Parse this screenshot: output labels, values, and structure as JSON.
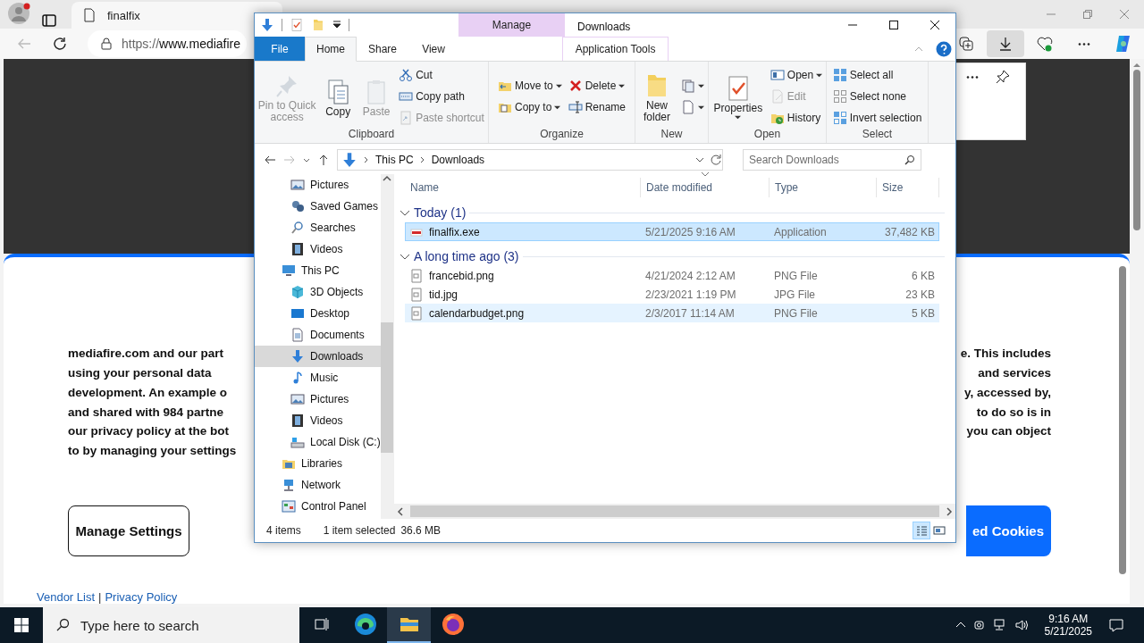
{
  "browser": {
    "tab": {
      "title": "finalfix"
    },
    "address": {
      "scheme": "https://",
      "host": "www.mediafire"
    },
    "toolbar_buttons": [
      {
        "kind": "collections",
        "selected": false
      },
      {
        "kind": "downloads",
        "selected": true
      },
      {
        "kind": "health",
        "selected": false
      },
      {
        "kind": "more",
        "selected": false
      },
      {
        "kind": "copilot",
        "selected": false
      }
    ]
  },
  "cookie_notice": {
    "left_lines": [
      "mediafire.com and our part",
      "using your personal data",
      "development. An example o",
      "and shared with 984 partne",
      "our privacy policy at the bot",
      "to by managing your settings"
    ],
    "right_lines": [
      "e. This includes",
      "and services",
      "y, accessed by,",
      "to do so is in",
      "you can object"
    ],
    "manage_button": "Manage Settings",
    "accept_button": "ed Cookies",
    "links": [
      "Vendor List",
      "Privacy Policy"
    ],
    "link_separator": "|"
  },
  "explorer": {
    "title": "Downloads",
    "context_group": "Manage",
    "tabs": [
      {
        "label": "File",
        "kind": "file",
        "selected": false
      },
      {
        "label": "Home",
        "kind": "tab",
        "selected": true
      },
      {
        "label": "Share",
        "kind": "tab",
        "selected": false
      },
      {
        "label": "View",
        "kind": "tab",
        "selected": false
      },
      {
        "label": "Application Tools",
        "kind": "context",
        "selected": false
      }
    ],
    "ribbon": [
      {
        "title": "Clipboard",
        "columns": [
          [
            {
              "kind": "large",
              "label": "Pin to Quick access",
              "disabled": true,
              "dropdown": false
            }
          ],
          [
            {
              "kind": "large",
              "label": "Copy",
              "disabled": false,
              "dropdown": false
            }
          ],
          [
            {
              "kind": "large",
              "label": "Paste",
              "disabled": true,
              "dropdown": false
            }
          ],
          [
            {
              "kind": "small",
              "label": "Cut",
              "disabled": false,
              "dropdown": false
            },
            {
              "kind": "small",
              "label": "Copy path",
              "disabled": false,
              "dropdown": false
            },
            {
              "kind": "small",
              "label": "Paste shortcut",
              "disabled": true,
              "dropdown": false
            }
          ]
        ]
      },
      {
        "title": "Organize",
        "columns": [
          [
            {
              "kind": "small",
              "label": "Move to",
              "disabled": false,
              "dropdown": true
            },
            {
              "kind": "small",
              "label": "Copy to",
              "disabled": false,
              "dropdown": true
            }
          ],
          [
            {
              "kind": "small",
              "label": "Delete",
              "disabled": false,
              "dropdown": true
            },
            {
              "kind": "small",
              "label": "Rename",
              "disabled": false,
              "dropdown": false
            }
          ]
        ]
      },
      {
        "title": "New",
        "columns": [
          [
            {
              "kind": "large",
              "label": "New folder",
              "disabled": false,
              "dropdown": false
            }
          ],
          [
            {
              "kind": "small",
              "disabled": false,
              "dropdown": true
            },
            {
              "kind": "small",
              "disabled": false,
              "dropdown": true
            }
          ]
        ]
      },
      {
        "title": "Open",
        "columns": [
          [
            {
              "kind": "large",
              "label": "Properties",
              "disabled": false,
              "dropdown": true
            }
          ],
          [
            {
              "kind": "small",
              "label": "Open",
              "disabled": false,
              "dropdown": true
            },
            {
              "kind": "small",
              "label": "Edit",
              "disabled": true,
              "dropdown": false
            },
            {
              "kind": "small",
              "label": "History",
              "disabled": false,
              "dropdown": false
            }
          ]
        ]
      },
      {
        "title": "Select",
        "columns": [
          [
            {
              "kind": "small",
              "label": "Select all",
              "disabled": false,
              "dropdown": false
            },
            {
              "kind": "small",
              "label": "Select none",
              "disabled": false,
              "dropdown": false
            },
            {
              "kind": "small",
              "label": "Invert selection",
              "disabled": false,
              "dropdown": false
            }
          ]
        ]
      }
    ],
    "breadcrumbs": [
      "This PC",
      "Downloads"
    ],
    "search_placeholder": "Search Downloads",
    "nav_pane": {
      "continued_items": [
        {
          "label": "Pictures",
          "kind": "pictures",
          "selected": false
        },
        {
          "label": "Saved Games",
          "kind": "games",
          "selected": false
        },
        {
          "label": "Searches",
          "kind": "searches",
          "selected": false
        },
        {
          "label": "Videos",
          "kind": "videos",
          "selected": false
        }
      ],
      "items": [
        {
          "label": "This PC",
          "kind": "pc",
          "selected": false,
          "children": [
            {
              "label": "3D Objects",
              "kind": "cube",
              "selected": false
            },
            {
              "label": "Desktop",
              "kind": "desktop",
              "selected": false
            },
            {
              "label": "Documents",
              "kind": "documents",
              "selected": false
            },
            {
              "label": "Downloads",
              "kind": "downloads",
              "selected": true
            },
            {
              "label": "Music",
              "kind": "music",
              "selected": false
            },
            {
              "label": "Pictures",
              "kind": "pictures",
              "selected": false
            },
            {
              "label": "Videos",
              "kind": "videos",
              "selected": false
            },
            {
              "label": "Local Disk (C:)",
              "kind": "disk",
              "selected": false
            }
          ]
        },
        {
          "label": "Libraries",
          "kind": "libraries",
          "selected": false
        },
        {
          "label": "Network",
          "kind": "network",
          "selected": false
        },
        {
          "label": "Control Panel",
          "kind": "controlpanel",
          "selected": false
        }
      ]
    },
    "columns": [
      "Name",
      "Date modified",
      "Type",
      "Size"
    ],
    "groups": [
      {
        "title": "Today (1)",
        "expanded": true,
        "files": [
          {
            "name": "finalfix.exe",
            "kind": "application",
            "date": "5/21/2025 9:16 AM",
            "type": "Application",
            "size": "37,482 KB",
            "selected": true,
            "hovered": false
          }
        ]
      },
      {
        "title": "A long time ago (3)",
        "expanded": true,
        "files": [
          {
            "name": "francebid.png",
            "kind": "image",
            "date": "4/21/2024 2:12 AM",
            "type": "PNG File",
            "size": "6 KB",
            "selected": false,
            "hovered": false
          },
          {
            "name": "tid.jpg",
            "kind": "image",
            "date": "2/23/2021 1:19 PM",
            "type": "JPG File",
            "size": "23 KB",
            "selected": false,
            "hovered": false
          },
          {
            "name": "calendarbudget.png",
            "kind": "image",
            "date": "2/3/2017 11:14 AM",
            "type": "PNG File",
            "size": "5 KB",
            "selected": false,
            "hovered": true
          }
        ]
      }
    ],
    "status": {
      "count": "4 items",
      "selection": "1 item selected",
      "size": "36.6 MB"
    },
    "views": [
      {
        "kind": "details",
        "selected": true
      },
      {
        "kind": "large",
        "selected": false
      }
    ]
  },
  "taskbar": {
    "search_placeholder": "Type here to search",
    "apps": [
      {
        "kind": "edge",
        "active": false
      },
      {
        "kind": "explorer",
        "active": true
      },
      {
        "kind": "firefox",
        "active": false
      }
    ],
    "time": "9:16 AM",
    "date": "5/21/2025"
  }
}
